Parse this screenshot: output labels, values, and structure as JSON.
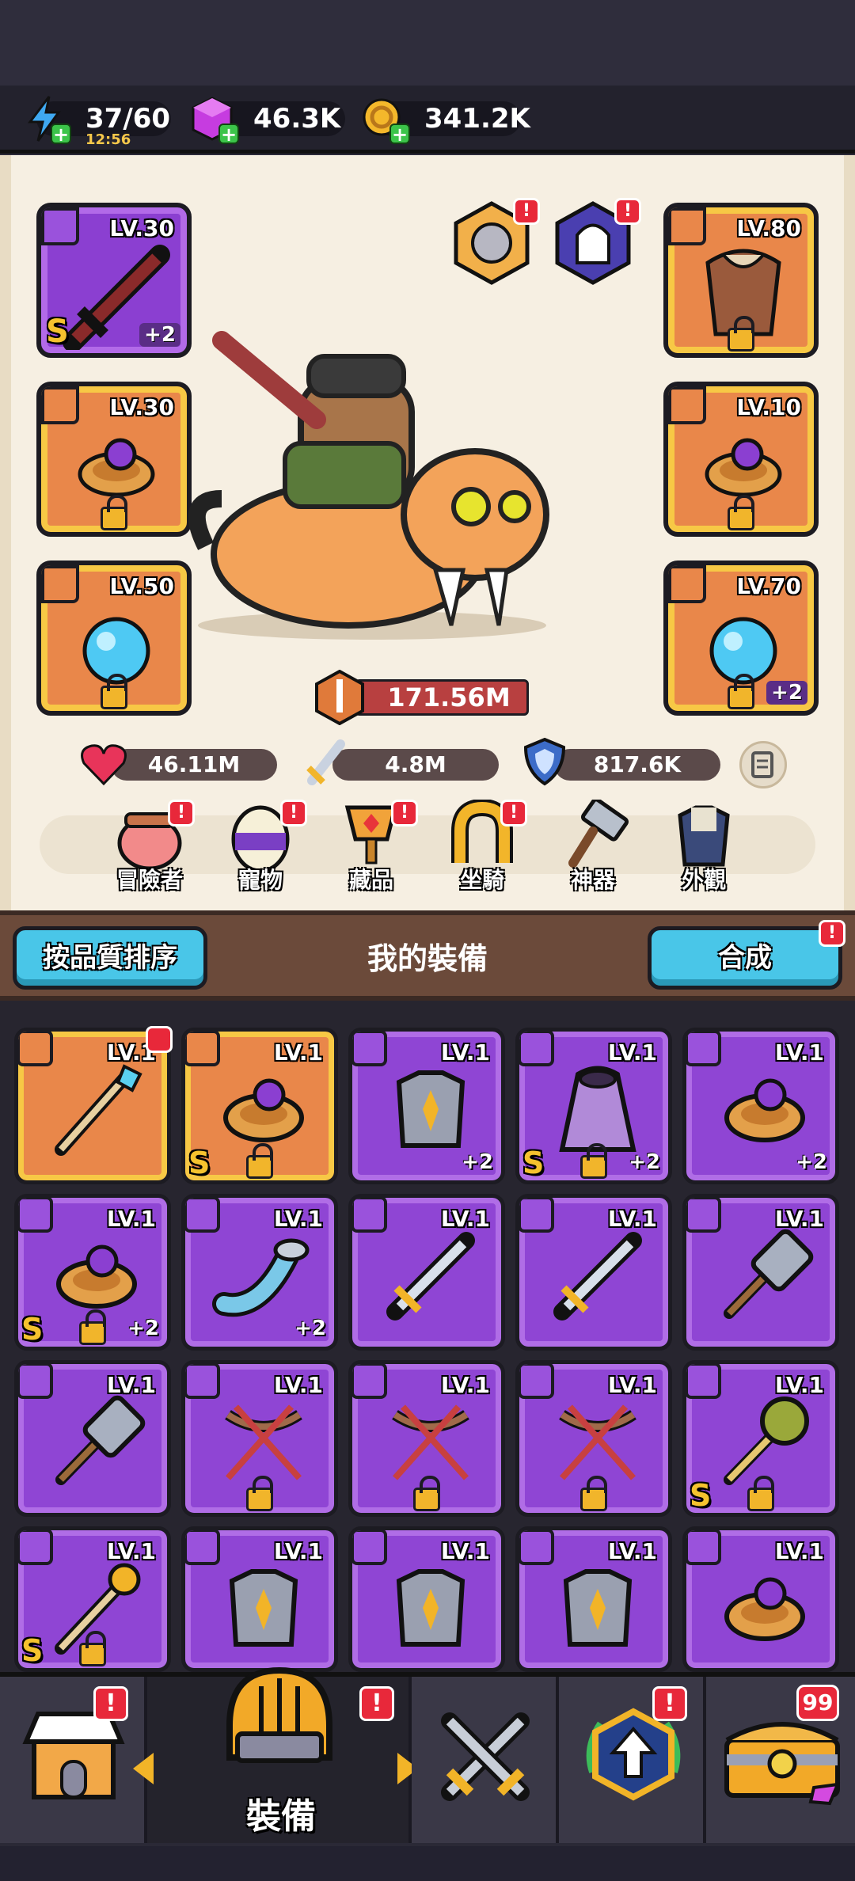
{
  "resources": {
    "energy": "37/60",
    "energy_timer": "12:56",
    "gems": "46.3K",
    "gold": "341.2K"
  },
  "equipped_left": [
    {
      "level": "LV.30",
      "plus": "+2",
      "grade": "S",
      "rarity": "purple"
    },
    {
      "level": "LV.30",
      "rarity": "orange",
      "locked": true
    },
    {
      "level": "LV.50",
      "rarity": "orange",
      "locked": true
    }
  ],
  "equipped_right": [
    {
      "level": "LV.80",
      "rarity": "orange",
      "locked": true
    },
    {
      "level": "LV.10",
      "rarity": "orange",
      "locked": true
    },
    {
      "level": "LV.70",
      "rarity": "orange",
      "locked": true,
      "plus": "+2"
    }
  ],
  "stats": {
    "power": "171.56M",
    "hp": "46.11M",
    "attack": "4.8M",
    "defense": "817.6K"
  },
  "categories": [
    "冒險者",
    "寵物",
    "藏品",
    "坐騎",
    "神器",
    "外觀"
  ],
  "inventory_header": {
    "sort_label": "按品質排序",
    "title": "我的裝備",
    "merge_label": "合成"
  },
  "inventory": [
    {
      "level": "LV.1",
      "rarity": "orange",
      "kind": "staff"
    },
    {
      "level": "LV.1",
      "rarity": "orange",
      "kind": "ring",
      "grade": "S",
      "locked": true
    },
    {
      "level": "LV.1",
      "rarity": "purple",
      "kind": "armor",
      "plus": "+2"
    },
    {
      "level": "LV.1",
      "rarity": "purple",
      "kind": "cloak",
      "grade": "S",
      "plus": "+2",
      "locked": true
    },
    {
      "level": "LV.1",
      "rarity": "purple",
      "kind": "ring",
      "plus": "+2"
    },
    {
      "level": "LV.1",
      "rarity": "purple",
      "kind": "ring",
      "grade": "S",
      "plus": "+2",
      "locked": true
    },
    {
      "level": "LV.1",
      "rarity": "purple",
      "kind": "horn",
      "plus": "+2"
    },
    {
      "level": "LV.1",
      "rarity": "purple",
      "kind": "sword"
    },
    {
      "level": "LV.1",
      "rarity": "purple",
      "kind": "sword"
    },
    {
      "level": "LV.1",
      "rarity": "purple",
      "kind": "hammer"
    },
    {
      "level": "LV.1",
      "rarity": "purple",
      "kind": "hammer"
    },
    {
      "level": "LV.1",
      "rarity": "purple",
      "kind": "bow",
      "locked": true
    },
    {
      "level": "LV.1",
      "rarity": "purple",
      "kind": "bow",
      "locked": true
    },
    {
      "level": "LV.1",
      "rarity": "purple",
      "kind": "bow",
      "locked": true
    },
    {
      "level": "LV.1",
      "rarity": "purple",
      "kind": "mace",
      "grade": "S",
      "locked": true
    },
    {
      "level": "LV.1",
      "rarity": "purple",
      "kind": "staff2",
      "grade": "S",
      "locked": true
    },
    {
      "level": "LV.1",
      "rarity": "purple",
      "kind": "armor"
    },
    {
      "level": "LV.1",
      "rarity": "purple",
      "kind": "armor"
    },
    {
      "level": "LV.1",
      "rarity": "purple",
      "kind": "armor"
    },
    {
      "level": "LV.1",
      "rarity": "purple",
      "kind": "ring"
    }
  ],
  "bottom_nav": {
    "active_label": "裝備",
    "chest_count": "99"
  }
}
